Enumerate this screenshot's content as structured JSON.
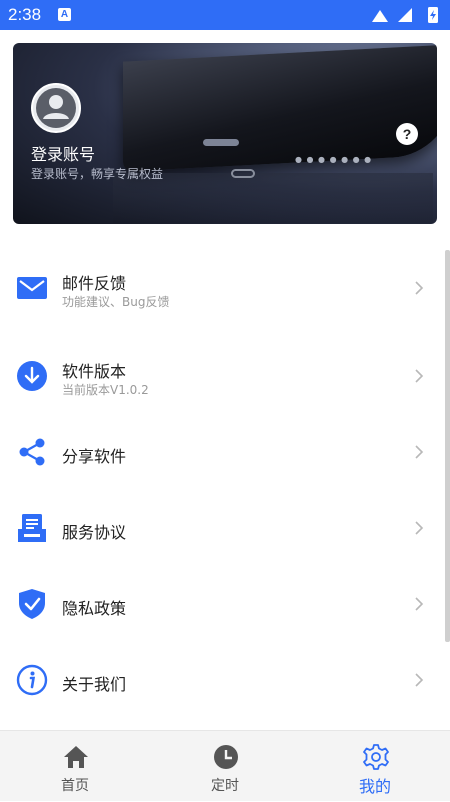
{
  "status_bar": {
    "time": "2:38",
    "notification_letter": "A"
  },
  "profile": {
    "login_title": "登录账号",
    "login_subtitle": "登录账号，畅享专属权益",
    "help_symbol": "?"
  },
  "menu": [
    {
      "id": "email",
      "title": "邮件反馈",
      "subtitle": "功能建议、Bug反馈",
      "icon": "mail-icon"
    },
    {
      "id": "version",
      "title": "软件版本",
      "subtitle": "当前版本V1.0.2",
      "icon": "download-icon"
    },
    {
      "id": "share",
      "title": "分享软件",
      "subtitle": "",
      "icon": "share-icon"
    },
    {
      "id": "agreement",
      "title": "服务协议",
      "subtitle": "",
      "icon": "document-icon"
    },
    {
      "id": "privacy",
      "title": "隐私政策",
      "subtitle": "",
      "icon": "shield-check-icon"
    },
    {
      "id": "about",
      "title": "关于我们",
      "subtitle": "",
      "icon": "info-icon"
    }
  ],
  "tabs": [
    {
      "label": "首页",
      "icon": "home-icon",
      "active": false
    },
    {
      "label": "定时",
      "icon": "clock-icon",
      "active": false
    },
    {
      "label": "我的",
      "icon": "gear-icon",
      "active": true
    }
  ],
  "colors": {
    "accent": "#2f6df6",
    "status_bar": "#2f6df6",
    "text": "#222222",
    "subtext": "#9a9a9a"
  }
}
